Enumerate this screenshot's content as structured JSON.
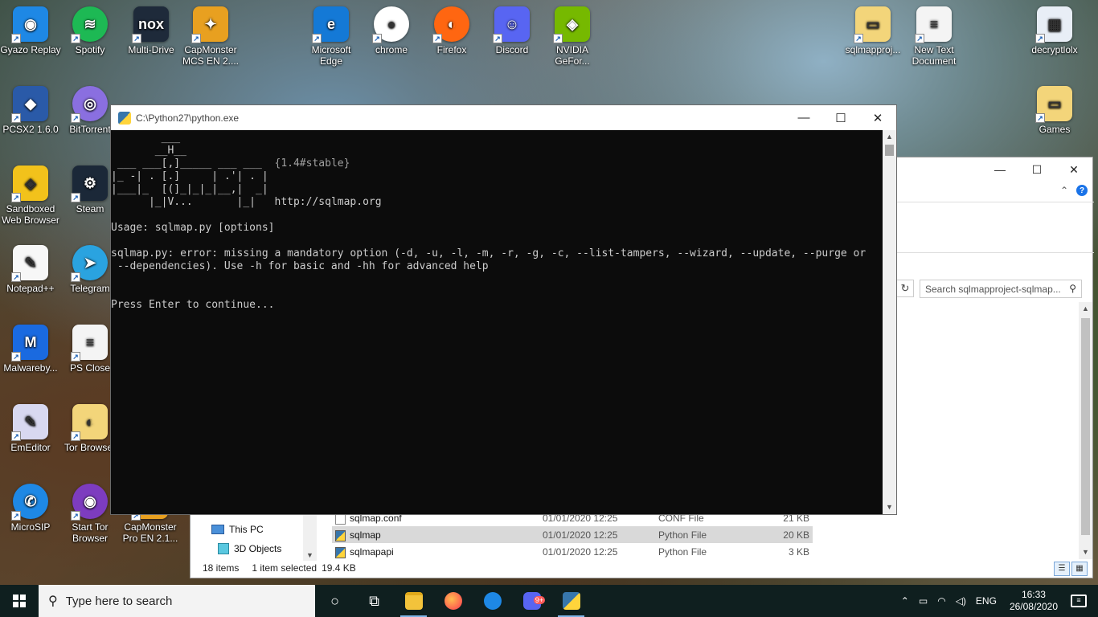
{
  "desktop": {
    "icons": [
      {
        "label": "Gyazo Replay",
        "color": "#1e88e5",
        "glyph": "◉"
      },
      {
        "label": "Spotify",
        "color": "#1db954",
        "glyph": "≋"
      },
      {
        "label": "Multi-Drive",
        "color": "#1e2a3a",
        "glyph": "nox"
      },
      {
        "label": "CapMonster MCS EN 2....",
        "color": "#e8a020",
        "glyph": "✦"
      },
      {
        "label": "Microsoft Edge",
        "color": "#1479d6",
        "glyph": "e"
      },
      {
        "label": "chrome",
        "color": "#ffffff",
        "glyph": "●"
      },
      {
        "label": "Firefox",
        "color": "#ff6611",
        "glyph": "◐"
      },
      {
        "label": "Discord",
        "color": "#5865f2",
        "glyph": "☺"
      },
      {
        "label": "NVIDIA GeFor...",
        "color": "#76b900",
        "glyph": "◈"
      },
      {
        "label": "sqlmapproj...",
        "color": "#f3d57a",
        "glyph": "▭"
      },
      {
        "label": "New Text Document",
        "color": "#f4f4f4",
        "glyph": "≡"
      },
      {
        "label": "decryptlolx",
        "color": "#e8eef6",
        "glyph": "▦"
      },
      {
        "label": "PCSX2 1.6.0",
        "color": "#2a5aa8",
        "glyph": "◆"
      },
      {
        "label": "BitTorrent",
        "color": "#8a6fe0",
        "glyph": "◎"
      },
      {
        "label": "Games",
        "color": "#f3d57a",
        "glyph": "▭"
      },
      {
        "label": "Sandboxed Web Browser",
        "color": "#f2c21b",
        "glyph": "◈"
      },
      {
        "label": "Steam",
        "color": "#1b2838",
        "glyph": "⚙"
      },
      {
        "label": "Notepad++",
        "color": "#f7f7f7",
        "glyph": "✎"
      },
      {
        "label": "Telegram",
        "color": "#2aa3e0",
        "glyph": "➤"
      },
      {
        "label": "Malwareby...",
        "color": "#1a6ae0",
        "glyph": "M"
      },
      {
        "label": "PS Close",
        "color": "#f4f4f4",
        "glyph": "≡"
      },
      {
        "label": "EmEditor",
        "color": "#d8d8f0",
        "glyph": "✎"
      },
      {
        "label": "Tor Browser",
        "color": "#f3d57a",
        "glyph": "◐"
      },
      {
        "label": "MicroSIP",
        "color": "#1e88e5",
        "glyph": "✆"
      },
      {
        "label": "Start Tor Browser",
        "color": "#7d3cbf",
        "glyph": "◉"
      },
      {
        "label": "CapMonster Pro EN 2.1...",
        "color": "#e8a020",
        "glyph": "✦"
      }
    ]
  },
  "console": {
    "title": "C:\\Python27\\python.exe",
    "banner_line0": "        ___",
    "banner_line1": "       __H__",
    "banner_line2": " ___ ___[,]_____ ___ ___  ",
    "banner_version": "{1.4#stable}",
    "banner_line3": "|_ -| . [.]     | .'| . |",
    "banner_line4": "|___|_  [(]_|_|_|__,|  _|",
    "banner_line5": "      |_|V...       |_|   ",
    "banner_url": "http://sqlmap.org",
    "usage": "Usage: sqlmap.py [options]",
    "error_line1": "sqlmap.py: error: missing a mandatory option (-d, -u, -l, -m, -r, -g, -c, --list-tampers, --wizard, --update, --purge or",
    "error_line2": " --dependencies). Use -h for basic and -hh for advanced help",
    "prompt": "Press Enter to continue..."
  },
  "explorer": {
    "search_placeholder": "Search sqlmapproject-sqlmap...",
    "nav": [
      {
        "label": "This PC"
      },
      {
        "label": "3D Objects"
      }
    ],
    "files": [
      {
        "name": "sqlmap.conf",
        "date": "01/01/2020 12:25",
        "type": "CONF File",
        "size": "21 KB",
        "icon": "file"
      },
      {
        "name": "sqlmap",
        "date": "01/01/2020 12:25",
        "type": "Python File",
        "size": "20 KB",
        "icon": "python"
      },
      {
        "name": "sqlmapapi",
        "date": "01/01/2020 12:25",
        "type": "Python File",
        "size": "3 KB",
        "icon": "python"
      }
    ],
    "status": {
      "items": "18 items",
      "selected": "1 item selected",
      "size": "19.4 KB"
    }
  },
  "taskbar": {
    "search_placeholder": "Type here to search",
    "badge": "9+",
    "language": "ENG",
    "time": "16:33",
    "date": "26/08/2020",
    "colors": {
      "taskbar_bg": "#0f1f1f",
      "console_bg": "#0c0c0c",
      "sqlmap_red": "#c50f1f"
    }
  }
}
